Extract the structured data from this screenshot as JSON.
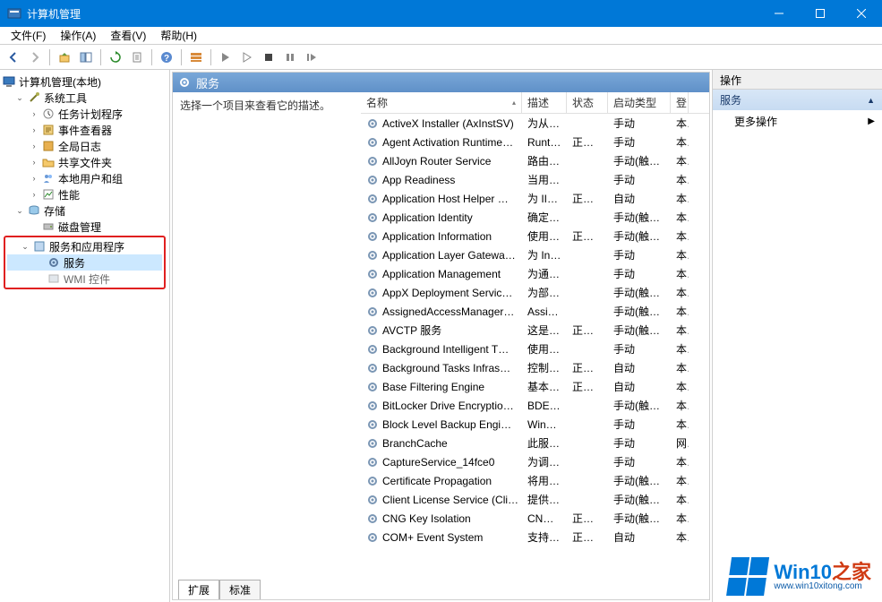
{
  "window": {
    "title": "计算机管理"
  },
  "menu": {
    "file": "文件(F)",
    "action": "操作(A)",
    "view": "查看(V)",
    "help": "帮助(H)"
  },
  "tree": {
    "root": "计算机管理(本地)",
    "system_tools": "系统工具",
    "task_scheduler": "任务计划程序",
    "event_viewer": "事件查看器",
    "global_log": "全局日志",
    "shared_folders": "共享文件夹",
    "local_users": "本地用户和组",
    "performance": "性能",
    "storage": "存储",
    "disk_mgmt": "磁盘管理",
    "services_apps": "服务和应用程序",
    "services": "服务",
    "wmi": "WMI 控件"
  },
  "services": {
    "title": "服务",
    "description_hint": "选择一个项目来查看它的描述。",
    "columns": {
      "name": "名称",
      "desc": "描述",
      "state": "状态",
      "startup": "启动类型",
      "logon": "登"
    },
    "rows": [
      {
        "name": "ActiveX Installer (AxInstSV)",
        "desc": "为从…",
        "state": "",
        "startup": "手动",
        "logon": "本"
      },
      {
        "name": "Agent Activation Runtime…",
        "desc": "Runt…",
        "state": "正在…",
        "startup": "手动",
        "logon": "本"
      },
      {
        "name": "AllJoyn Router Service",
        "desc": "路由…",
        "state": "",
        "startup": "手动(触发…",
        "logon": "本"
      },
      {
        "name": "App Readiness",
        "desc": "当用…",
        "state": "",
        "startup": "手动",
        "logon": "本"
      },
      {
        "name": "Application Host Helper …",
        "desc": "为 II…",
        "state": "正在…",
        "startup": "自动",
        "logon": "本"
      },
      {
        "name": "Application Identity",
        "desc": "确定…",
        "state": "",
        "startup": "手动(触发…",
        "logon": "本"
      },
      {
        "name": "Application Information",
        "desc": "使用…",
        "state": "正在…",
        "startup": "手动(触发…",
        "logon": "本"
      },
      {
        "name": "Application Layer Gatewa…",
        "desc": "为 In…",
        "state": "",
        "startup": "手动",
        "logon": "本"
      },
      {
        "name": "Application Management",
        "desc": "为通…",
        "state": "",
        "startup": "手动",
        "logon": "本"
      },
      {
        "name": "AppX Deployment Servic…",
        "desc": "为部…",
        "state": "",
        "startup": "手动(触发…",
        "logon": "本"
      },
      {
        "name": "AssignedAccessManager…",
        "desc": "Assi…",
        "state": "",
        "startup": "手动(触发…",
        "logon": "本"
      },
      {
        "name": "AVCTP 服务",
        "desc": "这是…",
        "state": "正在…",
        "startup": "手动(触发…",
        "logon": "本"
      },
      {
        "name": "Background Intelligent T…",
        "desc": "使用…",
        "state": "",
        "startup": "手动",
        "logon": "本"
      },
      {
        "name": "Background Tasks Infras…",
        "desc": "控制…",
        "state": "正在…",
        "startup": "自动",
        "logon": "本"
      },
      {
        "name": "Base Filtering Engine",
        "desc": "基本…",
        "state": "正在…",
        "startup": "自动",
        "logon": "本"
      },
      {
        "name": "BitLocker Drive Encryptio…",
        "desc": "BDE…",
        "state": "",
        "startup": "手动(触发…",
        "logon": "本"
      },
      {
        "name": "Block Level Backup Engi…",
        "desc": "Win…",
        "state": "",
        "startup": "手动",
        "logon": "本"
      },
      {
        "name": "BranchCache",
        "desc": "此服…",
        "state": "",
        "startup": "手动",
        "logon": "网"
      },
      {
        "name": "CaptureService_14fce0",
        "desc": "为调…",
        "state": "",
        "startup": "手动",
        "logon": "本"
      },
      {
        "name": "Certificate Propagation",
        "desc": "将用…",
        "state": "",
        "startup": "手动(触发…",
        "logon": "本"
      },
      {
        "name": "Client License Service (Cli…",
        "desc": "提供…",
        "state": "",
        "startup": "手动(触发…",
        "logon": "本"
      },
      {
        "name": "CNG Key Isolation",
        "desc": "CNG…",
        "state": "正在…",
        "startup": "手动(触发…",
        "logon": "本"
      },
      {
        "name": "COM+ Event System",
        "desc": "支持…",
        "state": "正在…",
        "startup": "自动",
        "logon": "本"
      }
    ]
  },
  "tabs": {
    "extended": "扩展",
    "standard": "标准"
  },
  "actions": {
    "header": "操作",
    "section": "服务",
    "more": "更多操作"
  },
  "watermark": {
    "brand_main": "Win10",
    "brand_suffix": "之家",
    "url": "www.win10xitong.com"
  }
}
